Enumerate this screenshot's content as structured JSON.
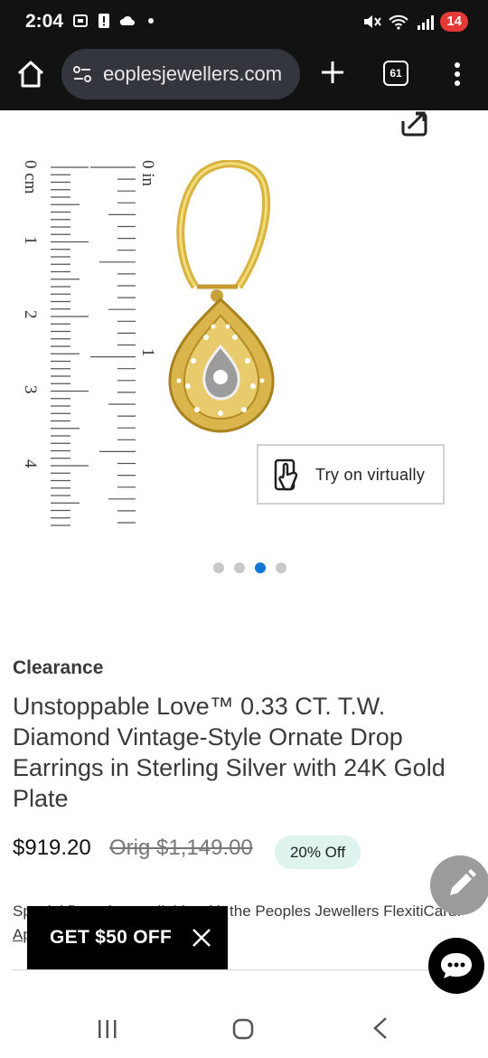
{
  "status_bar": {
    "time": "2:04",
    "battery_level": "14",
    "battery_color": "#e53935",
    "icons_left": [
      "screenshot-icon",
      "alert-icon",
      "cloud-icon",
      "dot-icon"
    ],
    "icons_right": [
      "mute-icon",
      "wifi-6e-icon",
      "signal-icon"
    ]
  },
  "browser": {
    "url": "eoplesjewellers.com",
    "tab_count": "61"
  },
  "gallery": {
    "ruler_cm_labels": [
      "0 cm",
      "1",
      "2",
      "3",
      "4"
    ],
    "ruler_in_labels": [
      "0 in",
      "1"
    ],
    "try_on_label": "Try on virtually",
    "slide_count": 4,
    "active_slide": 3,
    "active_dot_color": "#1577d4"
  },
  "product": {
    "badge": "Clearance",
    "title": "Unstoppable Love™ 0.33 CT. T.W. Diamond Vintage-Style Ornate Drop Earrings in Sterling Silver with 24K Gold Plate",
    "price": "$919.20",
    "original_price": "Orig $1,149.00",
    "discount": "20% Off",
    "financing_text": "Special financing available with the Peoples Jewellers FlexitiCard.",
    "financing_link": "Apply"
  },
  "promo": {
    "label": "GET $50 OFF"
  }
}
